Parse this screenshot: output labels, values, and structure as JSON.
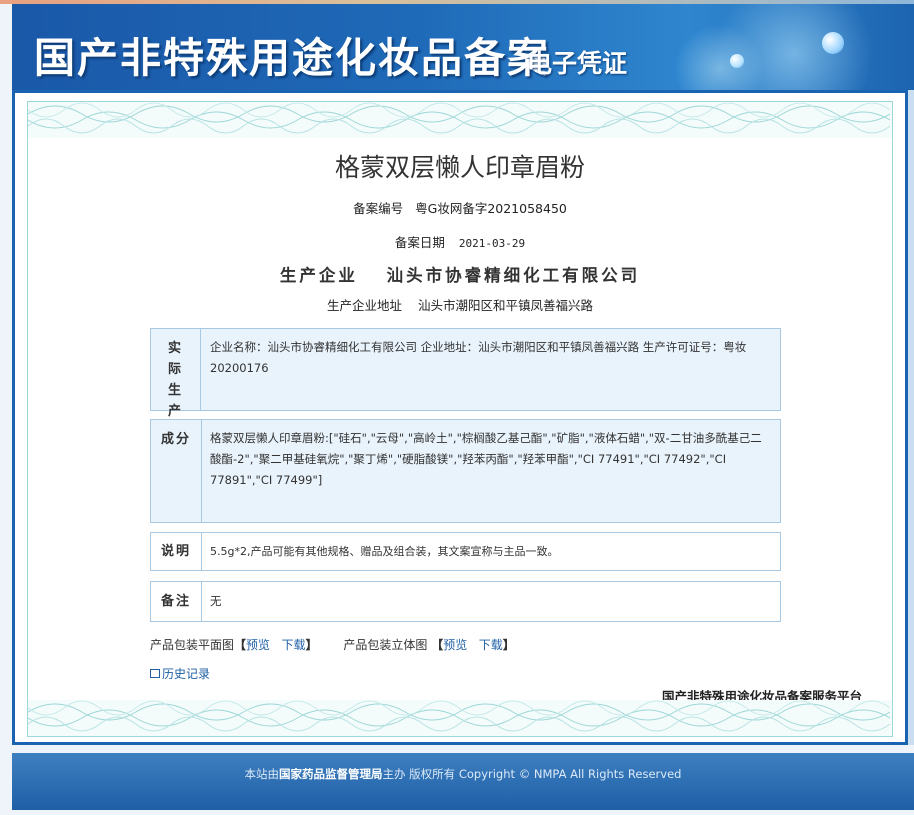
{
  "banner": {
    "title": "国产非特殊用途化妆品备案",
    "subtitle": "电子凭证"
  },
  "product": {
    "name": "格蒙双层懒人印章眉粉",
    "filing_no_label": "备案编号",
    "filing_no": "粤G妆网备字2021058450",
    "filing_date_label": "备案日期",
    "filing_date": "2021-03-29",
    "producer_label": "生产企业",
    "producer": "汕头市协睿精细化工有限公司",
    "producer_addr_label": "生产企业地址",
    "producer_addr": "汕头市潮阳区和平镇凤善福兴路"
  },
  "sections": {
    "actual_producer": {
      "label": "实际生产企业",
      "value": "企业名称：汕头市协睿精细化工有限公司    企业地址：汕头市潮阳区和平镇凤善福兴路    生产许可证号：粤妆20200176"
    },
    "ingredients": {
      "label": "成分",
      "value": "格蒙双层懒人印章眉粉:[\"硅石\",\"云母\",\"高岭土\",\"棕榈酸乙基己酯\",\"矿脂\",\"液体石蜡\",\"双-二甘油多酰基己二酸酯-2\",\"聚二甲基硅氧烷\",\"聚丁烯\",\"硬脂酸镁\",\"羟苯丙酯\",\"羟苯甲酯\",\"CI 77491\",\"CI 77492\",\"CI 77891\",\"CI 77499\"]"
    },
    "description": {
      "label": "说明",
      "value": "5.5g*2,产品可能有其他规格、赠品及组合装，其文案宣称与主品一致。"
    },
    "remark": {
      "label": "备注",
      "value": "无"
    }
  },
  "downloads": {
    "flat_label": "产品包装平面图",
    "stereo_label": "产品包装立体图",
    "preview": "预览",
    "download": "下载",
    "bracket_open": "【",
    "bracket_close": "】"
  },
  "history_link": "历史记录",
  "platform": "国产非特殊用途化妆品备案服务平台",
  "footer": {
    "prefix": "本站由",
    "org": "国家药品监督管理局",
    "suffix": "主办 版权所有 Copyright © NMPA All Rights Reserved"
  },
  "colors": {
    "banner_blue": "#1f6ab8",
    "frame_blue": "#1a63b0",
    "box_fill": "#e9f3fc",
    "link_blue": "#1f5fa6"
  }
}
